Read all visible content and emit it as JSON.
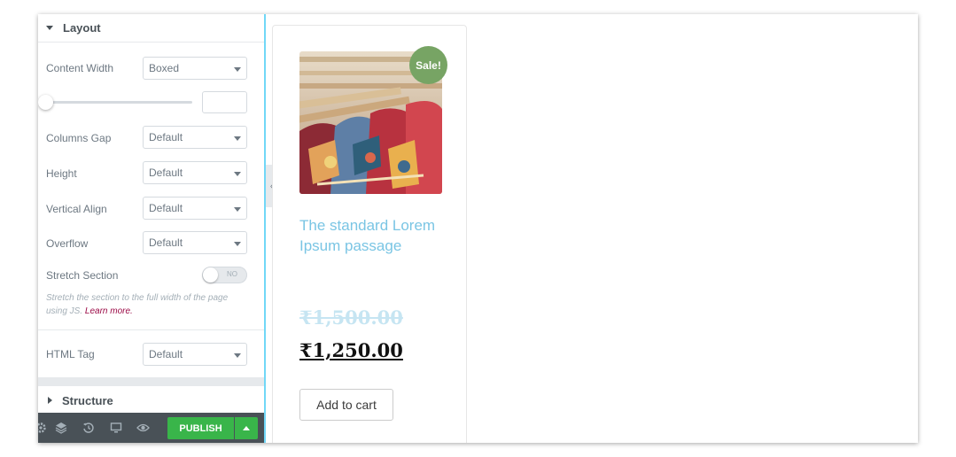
{
  "layout_section": {
    "title": "Layout"
  },
  "controls": {
    "content_width": {
      "label": "Content Width",
      "value": "Boxed"
    },
    "columns_gap": {
      "label": "Columns Gap",
      "value": "Default"
    },
    "height": {
      "label": "Height",
      "value": "Default"
    },
    "vertical_align": {
      "label": "Vertical Align",
      "value": "Default"
    },
    "overflow": {
      "label": "Overflow",
      "value": "Default"
    },
    "stretch_section": {
      "label": "Stretch Section",
      "toggle_text": "NO",
      "value": false
    },
    "stretch_description": "Stretch the section to the full width of the page using JS.",
    "learn_more": "Learn more.",
    "html_tag": {
      "label": "HTML Tag",
      "value": "Default"
    }
  },
  "structure_section": {
    "title": "Structure"
  },
  "footer": {
    "publish_label": "PUBLISH",
    "icons": [
      "settings-icon",
      "layers-icon",
      "history-icon",
      "responsive-icon",
      "preview-icon"
    ]
  },
  "product": {
    "sale_badge": "Sale!",
    "title": "The standard Lorem Ipsum passage",
    "old_price": "₹1,500.00",
    "new_price": "₹1,250.00",
    "add_to_cart": "Add to cart"
  },
  "colors": {
    "accent_green": "#39b54a",
    "sale_badge": "#77a464",
    "title_blue": "#7ac5e4",
    "panel_dark": "#495157"
  }
}
